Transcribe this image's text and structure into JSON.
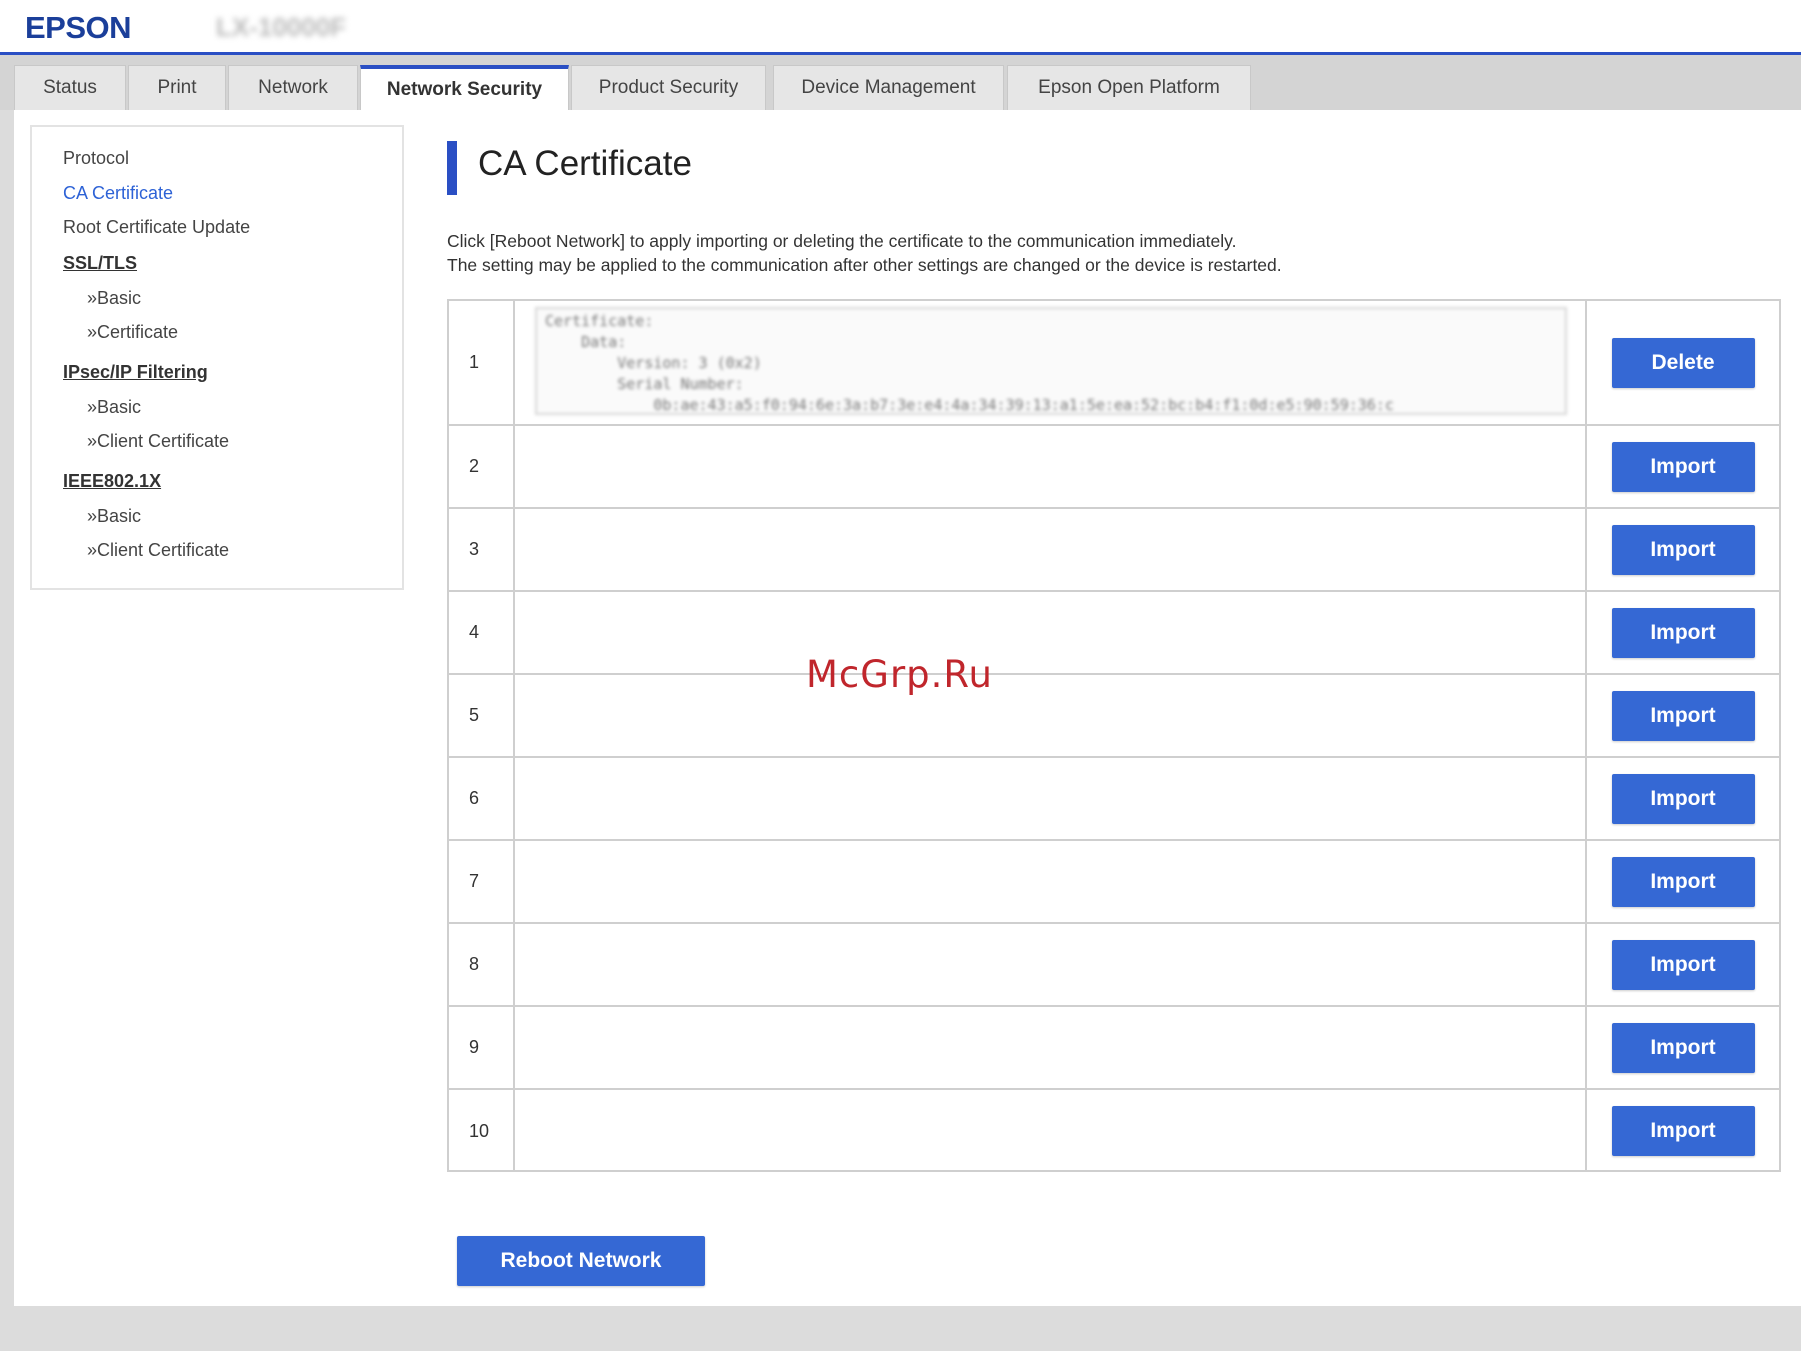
{
  "header": {
    "brand": "EPSON",
    "model": "LX-10000F"
  },
  "tabs": [
    {
      "label": "Status"
    },
    {
      "label": "Print"
    },
    {
      "label": "Network"
    },
    {
      "label": "Network Security",
      "active": true
    },
    {
      "label": "Product Security"
    },
    {
      "label": "Device Management"
    },
    {
      "label": "Epson Open Platform"
    }
  ],
  "sidebar": {
    "items": [
      {
        "label": "Protocol"
      },
      {
        "label": "CA Certificate",
        "active": true
      },
      {
        "label": "Root Certificate Update"
      },
      {
        "label": "SSL/TLS",
        "section": true
      },
      {
        "label": "»Basic"
      },
      {
        "label": "»Certificate"
      },
      {
        "label": "IPsec/IP Filtering",
        "section": true
      },
      {
        "label": "»Basic"
      },
      {
        "label": "»Client Certificate"
      },
      {
        "label": "IEEE802.1X",
        "section": true
      },
      {
        "label": "»Basic"
      },
      {
        "label": "»Client Certificate"
      }
    ]
  },
  "main": {
    "title": "CA Certificate",
    "description_line1": "Click [Reboot Network] to apply importing or deleting the certificate to the communication immediately.",
    "description_line2": "The setting may be applied to the communication after other settings are changed or the device is restarted.",
    "certificate_text": "Certificate:\n    Data:\n        Version: 3 (0x2)\n        Serial Number:\n            0b:ae:43:a5:f0:94:6e:3a:b7:3e:e4:4a:34:39:13:a1:5e:ea:52:bc:b4:f1:0d:e5:90:59:36:c",
    "rows": [
      {
        "num": "1",
        "action": "Delete"
      },
      {
        "num": "2",
        "action": "Import"
      },
      {
        "num": "3",
        "action": "Import"
      },
      {
        "num": "4",
        "action": "Import"
      },
      {
        "num": "5",
        "action": "Import"
      },
      {
        "num": "6",
        "action": "Import"
      },
      {
        "num": "7",
        "action": "Import"
      },
      {
        "num": "8",
        "action": "Import"
      },
      {
        "num": "9",
        "action": "Import"
      },
      {
        "num": "10",
        "action": "Import"
      }
    ],
    "reboot_label": "Reboot Network"
  },
  "watermark": "McGrp.Ru",
  "colors": {
    "accent": "#2a4fc4",
    "button": "#3568d4",
    "link_active": "#2d62d6"
  }
}
